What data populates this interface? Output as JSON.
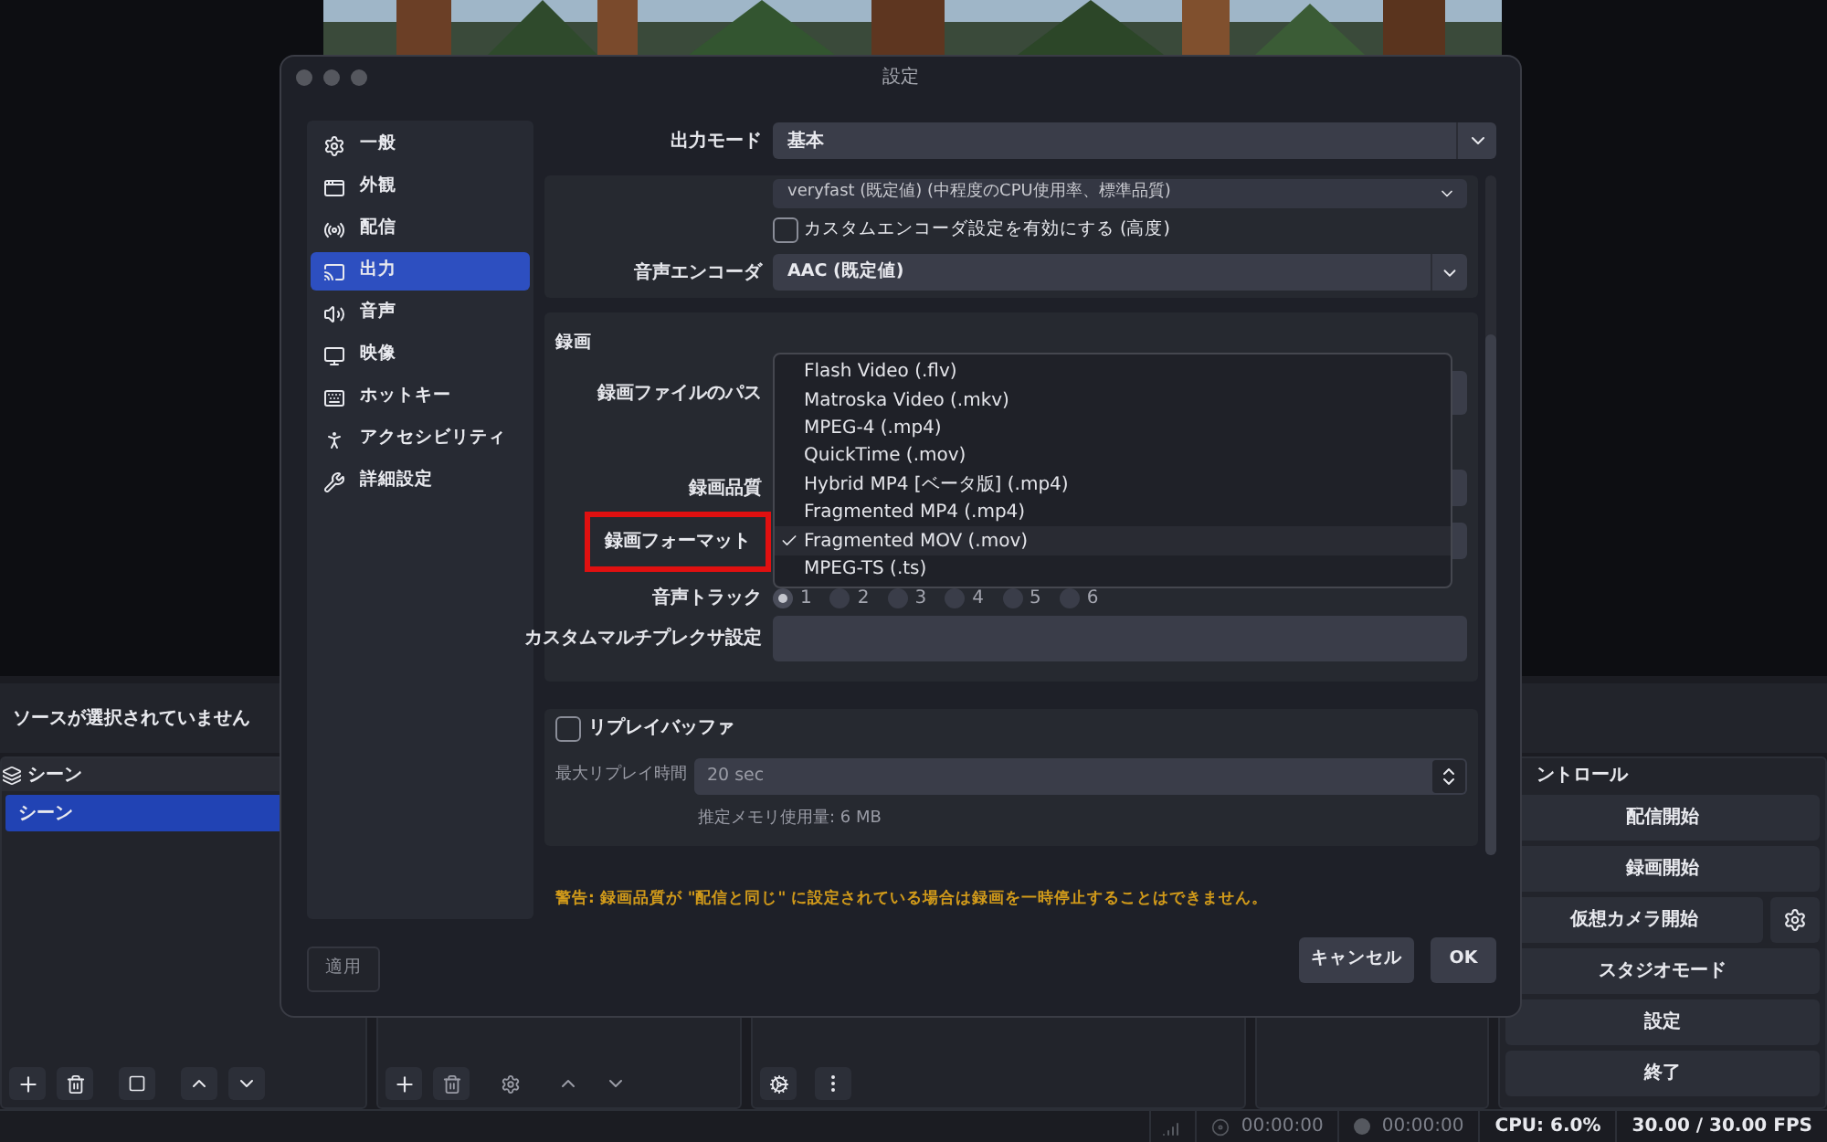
{
  "source_bar": {
    "text": "ソースが選択されていません"
  },
  "scenes_dock": {
    "title": "シーン",
    "items": [
      {
        "label": "シーン",
        "selected": true
      }
    ]
  },
  "controls_dock": {
    "title": "ントロール",
    "buttons": [
      {
        "label": "配信開始",
        "kind": "plain"
      },
      {
        "label": "録画開始",
        "kind": "plain"
      },
      {
        "label": "仮想カメラ開始",
        "kind": "with_settings"
      },
      {
        "label": "スタジオモード",
        "kind": "plain"
      },
      {
        "label": "設定",
        "kind": "plain"
      },
      {
        "label": "終了",
        "kind": "plain"
      }
    ]
  },
  "status_bar": {
    "stream_time": "00:00:00",
    "record_time": "00:00:00",
    "cpu": "CPU: 6.0%",
    "fps": "30.00 / 30.00 FPS"
  },
  "dialog": {
    "title": "設定",
    "sidebar": [
      {
        "label": "一般",
        "selected": false
      },
      {
        "label": "外観",
        "selected": false
      },
      {
        "label": "配信",
        "selected": false
      },
      {
        "label": "出力",
        "selected": true
      },
      {
        "label": "音声",
        "selected": false
      },
      {
        "label": "映像",
        "selected": false
      },
      {
        "label": "ホットキー",
        "selected": false
      },
      {
        "label": "アクセシビリティ",
        "selected": false
      },
      {
        "label": "詳細設定",
        "selected": false
      }
    ],
    "output_mode": {
      "label": "出力モード",
      "value": "基本"
    },
    "encoder_preset": {
      "value": "veryfast (既定値) (中程度のCPU使用率、標準品質)"
    },
    "custom_encoder": {
      "label": "カスタムエンコーダ設定を有効にする (高度)",
      "checked": false
    },
    "audio_encoder": {
      "label": "音声エンコーダ",
      "value": "AAC (既定値)"
    },
    "recording": {
      "title": "録画",
      "path_label": "録画ファイルのパス",
      "quality_label": "録画品質",
      "format_label": "録画フォーマット",
      "format_highlighted": true,
      "tracks_label": "音声トラック",
      "tracks": [
        {
          "label": "1",
          "selected": true
        },
        {
          "label": "2",
          "selected": false
        },
        {
          "label": "3",
          "selected": false
        },
        {
          "label": "4",
          "selected": false
        },
        {
          "label": "5",
          "selected": false
        },
        {
          "label": "6",
          "selected": false
        }
      ],
      "muxer_label": "カスタムマルチプレクサ設定"
    },
    "format_menu": [
      {
        "label": "Flash Video (.flv)",
        "selected": false
      },
      {
        "label": "Matroska Video (.mkv)",
        "selected": false
      },
      {
        "label": "MPEG-4 (.mp4)",
        "selected": false
      },
      {
        "label": "QuickTime (.mov)",
        "selected": false
      },
      {
        "label": "Hybrid MP4 [ベータ版] (.mp4)",
        "selected": false
      },
      {
        "label": "Fragmented MP4 (.mp4)",
        "selected": false
      },
      {
        "label": "Fragmented MOV (.mov)",
        "selected": true
      },
      {
        "label": "MPEG-TS (.ts)",
        "selected": false
      }
    ],
    "replay_buffer": {
      "label": "リプレイバッファ",
      "checked": false,
      "max_time_label": "最大リプレイ時間",
      "max_time": "20 sec",
      "memory": "推定メモリ使用量: 6 MB"
    },
    "warning": "警告: 録画品質が \"配信と同じ\" に設定されている場合は録画を一時停止することはできません。",
    "buttons": {
      "apply": "適用",
      "cancel": "キャンセル",
      "ok": "OK"
    }
  }
}
